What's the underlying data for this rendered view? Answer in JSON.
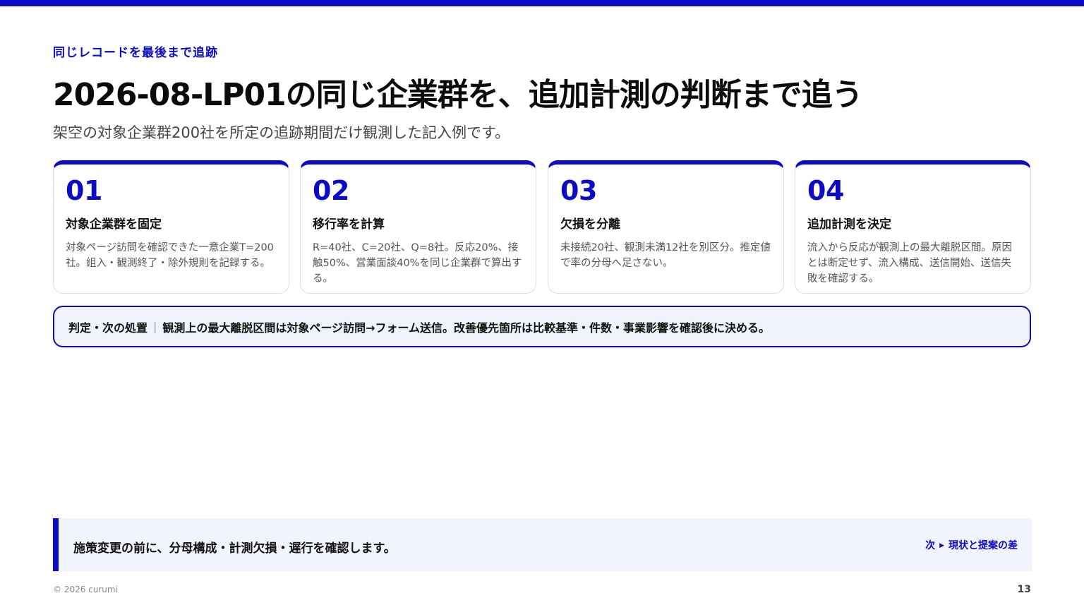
{
  "eyebrow": "同じレコードを最後まで追跡",
  "title": "2026-08-LP01の同じ企業群を、追加計測の判断まで追う",
  "subtitle": "架空の対象企業群200社を所定の追跡期間だけ観測した記入例です。",
  "cards": [
    {
      "num": "01",
      "title": "対象企業群を固定",
      "body": "対象ページ訪問を確認できた一意企業T=200社。組入・観測終了・除外規則を記録する。"
    },
    {
      "num": "02",
      "title": "移行率を計算",
      "body": "R=40社、C=20社、Q=8社。反応20%、接触50%、営業面談40%を同じ企業群で算出する。"
    },
    {
      "num": "03",
      "title": "欠損を分離",
      "body": "未接続20社、観測未満12社を別区分。推定値で率の分母へ足さない。"
    },
    {
      "num": "04",
      "title": "追加計測を決定",
      "body": "流入から反応が観測上の最大離脱区間。原因とは断定せず、流入構成、送信開始、送信失敗を確認する。"
    }
  ],
  "verdict": {
    "label": "判定・次の処置",
    "separator": "|",
    "text": "観測上の最大離脱区間は対象ページ訪問→フォーム送信。改善優先箇所は比較基準・件数・事業影響を確認後に決める。"
  },
  "footer": {
    "message": "施策変更の前に、分母構成・計測欠損・遅行を確認します。",
    "next_prefix": "次",
    "next_arrow": "▶",
    "next_label": "現状と提案の差"
  },
  "copyright": "© 2026 curumi",
  "page_number": "13",
  "colors": {
    "accent": "#0a0ac8",
    "band": "#f1f4fc"
  }
}
